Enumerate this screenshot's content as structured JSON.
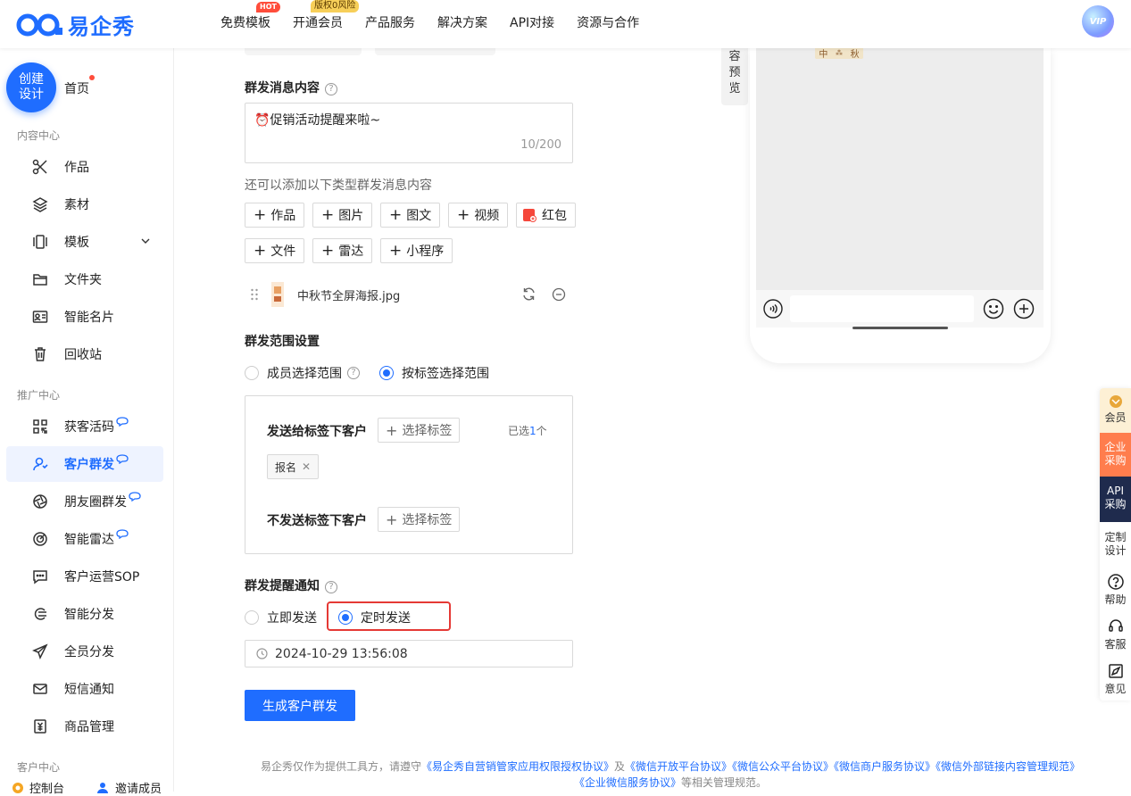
{
  "header": {
    "logo_text": "易企秀",
    "nav": [
      {
        "label": "免费模板",
        "badge": "HOT"
      },
      {
        "label": "开通会员",
        "badge": "版权0风险"
      },
      {
        "label": "产品服务"
      },
      {
        "label": "解决方案"
      },
      {
        "label": "API对接"
      },
      {
        "label": "资源与合作"
      }
    ],
    "vip_label": "VIP"
  },
  "sidebar": {
    "create_label_1": "创建",
    "create_label_2": "设计",
    "home_label": "首页",
    "section_content": "内容中心",
    "content_items": [
      "作品",
      "素材",
      "模板",
      "文件夹",
      "智能名片",
      "回收站"
    ],
    "section_promo": "推广中心",
    "promo_items": [
      "获客活码",
      "客户群发",
      "朋友圈群发",
      "智能雷达",
      "客户运营SOP",
      "智能分发",
      "全员分发",
      "短信通知",
      "商品管理"
    ],
    "section_customer": "客户中心",
    "bottom_items": [
      "控制台",
      "邀请成员"
    ]
  },
  "form": {
    "content_label": "群发消息内容",
    "message_text": "⏰促销活动提醒来啦~",
    "counter": "10/200",
    "add_hint": "还可以添加以下类型群发消息内容",
    "add_buttons_row1": [
      "作品",
      "图片",
      "图文",
      "视频",
      "红包"
    ],
    "add_buttons_row2": [
      "文件",
      "雷达",
      "小程序"
    ],
    "attachment_name": "中秋节全屏海报.jpg",
    "range_label": "群发范围设置",
    "range_options": [
      "成员选择范围",
      "按标签选择范围"
    ],
    "send_to_label": "发送给标签下客户",
    "select_tag": "选择标签",
    "selected_prefix": "已选",
    "selected_count": "1",
    "selected_suffix": "个",
    "chip": "报名",
    "exclude_label": "不发送标签下客户",
    "notify_label": "群发提醒通知",
    "notify_options": [
      "立即发送",
      "定时发送"
    ],
    "datetime": "2024-10-29 13:56:08",
    "submit": "生成客户群发"
  },
  "preview": {
    "tab_chars": [
      "容",
      "预",
      "览"
    ],
    "poster_chars": [
      "中",
      "秋"
    ]
  },
  "float_menu": {
    "items": [
      "会员",
      "企业采购",
      "API采购",
      "定制设计",
      "帮助",
      "客服",
      "意见"
    ]
  },
  "footer": {
    "prefix": "易企秀仅作为提供工具方，请遵守",
    "link1": "《易企秀自营销管家应用权限授权协议》",
    "and": "及",
    "link2": "《微信开放平台协议》",
    "link3": "《微信公众平台协议》",
    "link4": "《微信商户服务协议》",
    "link5": "《微信外部链接内容管理规范》",
    "link6": "《企业微信服务协议》",
    "suffix": "等相关管理规范。"
  },
  "colors": {
    "brand": "#1f6dff",
    "highlight": "#e53935",
    "dot": "#ff4d3b"
  }
}
